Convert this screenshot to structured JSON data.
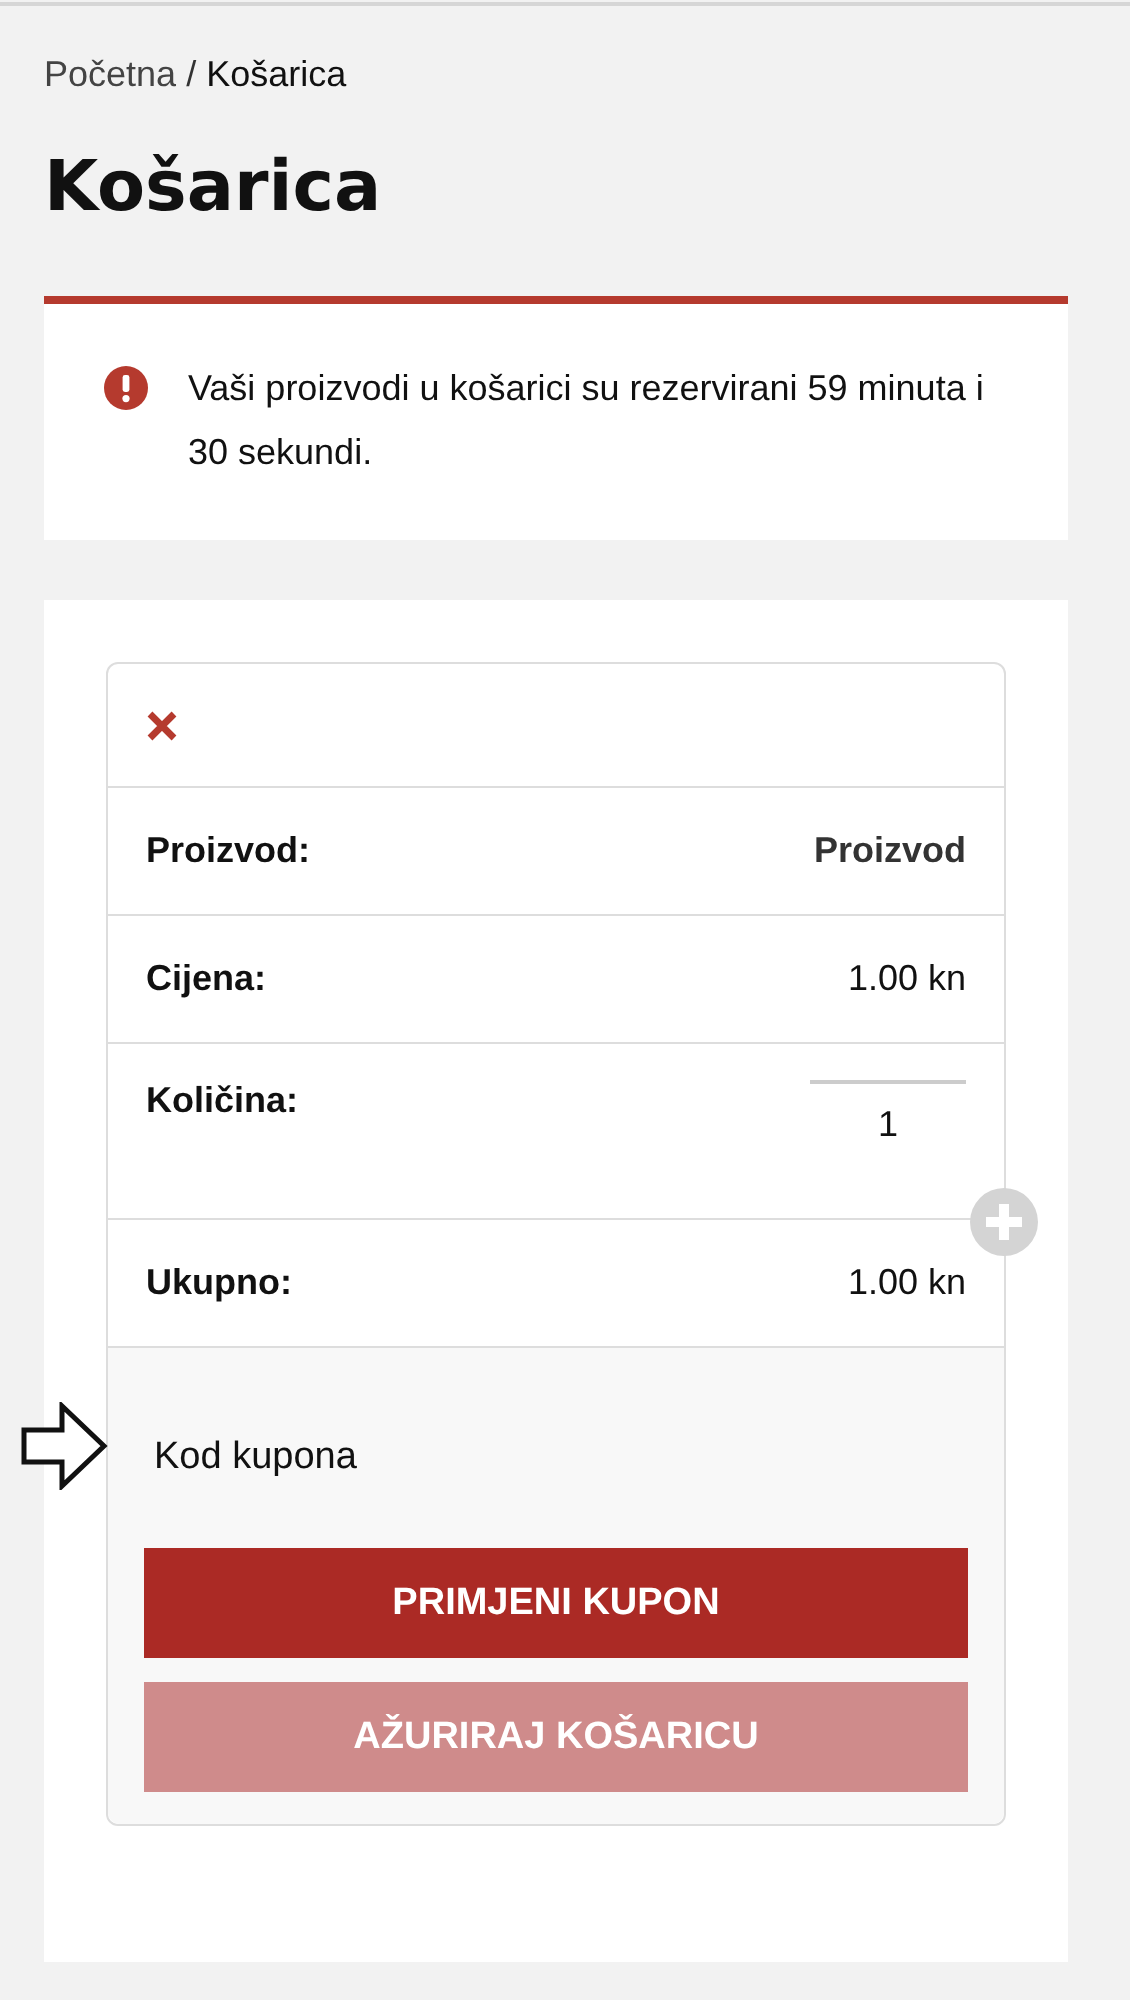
{
  "breadcrumb": {
    "separator": "/",
    "items": [
      {
        "label": "Početna",
        "kind": "link"
      },
      {
        "label": "Košarica",
        "kind": "current"
      }
    ]
  },
  "title": "Košarica",
  "notice": {
    "text": "Vaši proizvodi u košarici su rezervirani 59 minuta i 30 sekundi."
  },
  "cart_item": {
    "rows": [
      {
        "kind": "text",
        "label": "Proizvod:",
        "value": "Proizvod"
      },
      {
        "kind": "price",
        "label": "Cijena:",
        "value": "1.00 kn"
      },
      {
        "kind": "quantity",
        "label": "Količina:",
        "value": "1"
      },
      {
        "kind": "price",
        "label": "Ukupno:",
        "value": "1.00 kn"
      }
    ]
  },
  "coupon": {
    "placeholder": "Kod kupona"
  },
  "buttons": [
    {
      "label": "PRIMJENI KUPON",
      "disabled": false
    },
    {
      "label": "AŽURIRAJ KOŠARICU",
      "disabled": true
    }
  ]
}
